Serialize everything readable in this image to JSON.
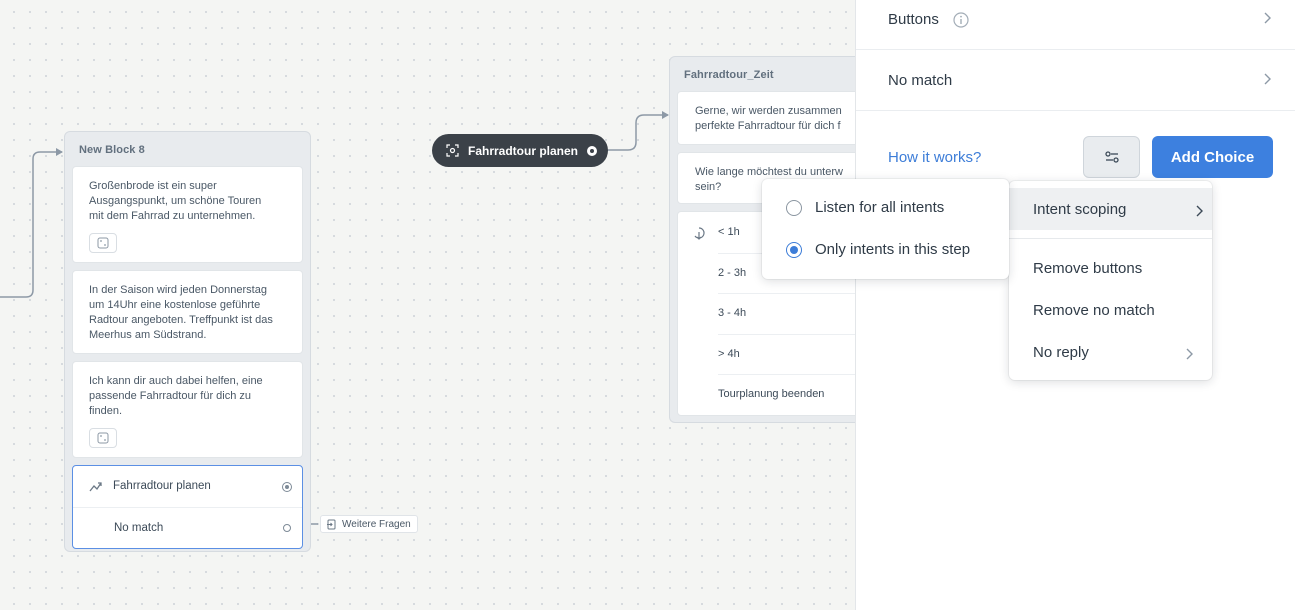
{
  "canvas": {
    "block1": {
      "title": "New Block 8",
      "steps": [
        "Großenbrode ist ein super\nAusgangspunkt, um schöne Touren\nmit dem Fahrrad zu unternehmen.",
        "In der Saison wird jeden Donnerstag\num 14Uhr eine kostenlose geführte\nRadtour angeboten. Treffpunkt ist das\nMeerhus am Südstrand.",
        "Ich kann dir auch dabei helfen, eine\npassende Fahrradtour für dich zu\nfinden."
      ],
      "choice_label": "Fahrradtour planen",
      "no_match_label": "No match"
    },
    "weiter_tag": "Weitere Fragen",
    "intent_pill": "Fahrradtour planen",
    "block2": {
      "title": "Fahrradtour_Zeit",
      "step1": "Gerne, wir werden zusammen\nperfekte Fahrradtour für dich f",
      "step2": "Wie lange möchtest du unterw\nsein?",
      "options": [
        "< 1h",
        "2 - 3h",
        "3 - 4h",
        "> 4h",
        "Tourplanung beenden"
      ]
    }
  },
  "panel": {
    "buttons_label": "Buttons",
    "no_match_label": "No match",
    "how_it_works": "How it works?",
    "add_choice": "Add Choice"
  },
  "menu": {
    "intent_scoping": "Intent scoping",
    "remove_buttons": "Remove buttons",
    "remove_no_match": "Remove no match",
    "no_reply": "No reply"
  },
  "submenu": {
    "listen_all": "Listen for all intents",
    "only_step": "Only intents in this step",
    "selected": "Only intents in this step"
  },
  "colors": {
    "accent": "#3d80df",
    "pill_bg": "#3b4148",
    "canvas_bg": "#f4f5f3"
  }
}
